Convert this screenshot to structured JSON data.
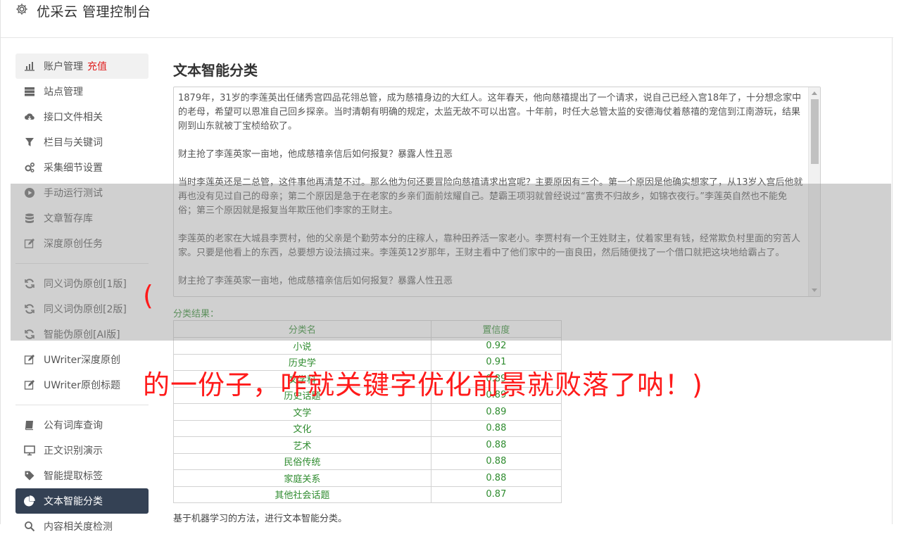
{
  "header": {
    "title": "优采云 管理控制台",
    "icon": "gear-icon"
  },
  "sidebar": {
    "group1": [
      {
        "label": "账户管理",
        "tag": "充值",
        "icon": "bar-chart-icon"
      },
      {
        "label": "站点管理",
        "icon": "server-icon"
      },
      {
        "label": "接口文件相关",
        "icon": "cloud-download-icon"
      },
      {
        "label": "栏目与关键词",
        "icon": "filter-icon"
      },
      {
        "label": "采集细节设置",
        "icon": "gears-icon"
      },
      {
        "label": "手动运行测试",
        "icon": "play-icon"
      },
      {
        "label": "文章暂存库",
        "icon": "database-icon"
      },
      {
        "label": "深度原创任务",
        "icon": "edit-icon"
      }
    ],
    "group2": [
      {
        "label": "同义词伪原创[1版]",
        "icon": "refresh-icon"
      },
      {
        "label": "同义词伪原创[2版]",
        "icon": "refresh-icon"
      },
      {
        "label": "智能伪原创[AI版]",
        "icon": "refresh-icon"
      },
      {
        "label": "UWriter深度原创",
        "icon": "edit-icon"
      },
      {
        "label": "UWriter原创标题",
        "icon": "edit-icon"
      }
    ],
    "group3": [
      {
        "label": "公有词库查询",
        "icon": "book-icon"
      },
      {
        "label": "正文识别演示",
        "icon": "monitor-icon"
      },
      {
        "label": "智能提取标签",
        "icon": "tag-icon"
      },
      {
        "label": "文本智能分类",
        "icon": "pie-chart-icon"
      },
      {
        "label": "内容相关度检测",
        "icon": "search-icon"
      }
    ]
  },
  "main": {
    "title": "文本智能分类",
    "article": [
      "1879年，31岁的李莲英出任储秀宫四品花翎总管，成为慈禧身边的大红人。这年春天，他向慈禧提出了一个请求，说自己已经入宫18年了，十分想念家中的老母，希望可以恩准自己回乡探亲。当时清朝有明确的规定，太监无故不可以出宫。十年前，时任大总管太监的安德海仗着慈禧的宠信到江南游玩，结果刚到山东就被丁宝桢给砍了。",
      "财主抢了李莲英家一亩地，他成慈禧亲信后如何报复？暴露人性丑恶",
      "当时李莲英还是二总管，这件事他再清楚不过。那么他为何还要冒险向慈禧请求出宫呢？主要原因有三个。第一个原因是他确实想家了，从13岁入宫后他就再也没有见过自己的母亲；第二个原因是急于在老家的乡亲们面前炫耀自己。楚霸王项羽就曾经说过“富贵不归故乡，如锦衣夜行。”李莲英自然也不能免俗；第三个原因就是报复当年欺压他们李家的王财主。",
      "李莲英的老家在大城县李贾村，他的父亲是个勤劳本分的庄稼人，靠种田养活一家老小。李贾村有一个王姓财主，仗着家里有钱，经常欺负村里面的穷苦人家。只要是他看上的东西，总要想方设法搞过来。李莲英12岁那年，王财主看中了他们家中的一亩良田，然后随便找了一个借口就把这块地给霸占了。",
      "财主抢了李莲英家一亩地，他成慈禧亲信后如何报复？暴露人性丑恶"
    ],
    "result_label": "分类结果：",
    "table": {
      "headers": [
        "分类名",
        "置信度"
      ],
      "rows": [
        [
          "小说",
          "0.92"
        ],
        [
          "历史学",
          "0.91"
        ],
        [
          "文学科",
          "0.89"
        ],
        [
          "历史话题",
          "0.89"
        ],
        [
          "文学",
          "0.89"
        ],
        [
          "文化",
          "0.88"
        ],
        [
          "艺术",
          "0.88"
        ],
        [
          "民俗传统",
          "0.88"
        ],
        [
          "家庭关系",
          "0.88"
        ],
        [
          "其他社会话题",
          "0.87"
        ]
      ]
    },
    "footnote": "基于机器学习的方法，进行文本智能分类。"
  },
  "overlay": {
    "paren": "(",
    "caption": "的一份子，咋就关键字优化前景就败落了呐！)"
  }
}
